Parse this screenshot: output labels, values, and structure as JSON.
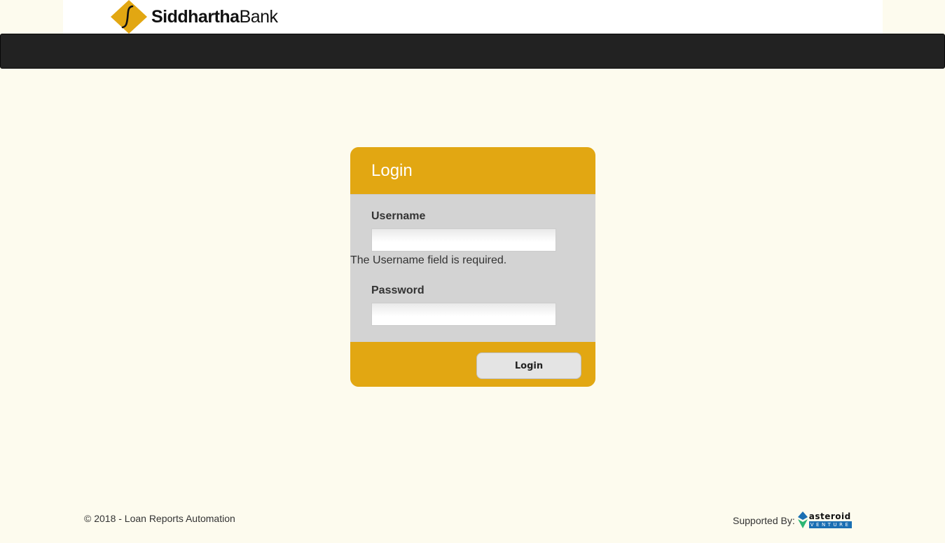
{
  "brand": {
    "name_bold": "Siddhartha",
    "name_light": "Bank",
    "accent_color": "#e2a712",
    "logo_icon": "siddhartha-diamond-logo"
  },
  "navbar": {
    "background": "#222222"
  },
  "login": {
    "title": "Login",
    "username_label": "Username",
    "username_value": "",
    "username_error": "The Username field is required.",
    "password_label": "Password",
    "password_value": "",
    "submit_label": "Login"
  },
  "footer": {
    "copyright": "© 2018 - Loan Reports Automation",
    "supported_by_label": "Supported By:",
    "sponsor_word": "asteroid",
    "sponsor_sub": "VENTURE",
    "sponsor_icon": "asteroid-logo"
  }
}
